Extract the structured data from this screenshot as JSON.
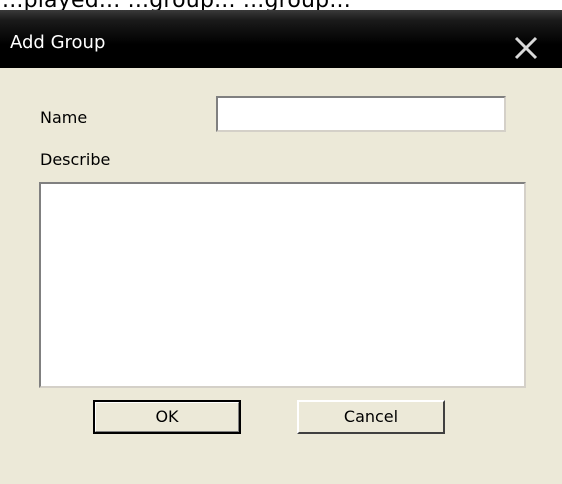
{
  "background_window": {
    "partial_text": "...played... ...group... ...group..."
  },
  "dialog": {
    "title": "Add Group",
    "close_glyph": "✕",
    "fields": {
      "name": {
        "label": "Name",
        "value": "",
        "placeholder": ""
      },
      "describe": {
        "label": "Describe",
        "value": "",
        "placeholder": ""
      }
    },
    "buttons": {
      "ok": "OK",
      "cancel": "Cancel"
    }
  },
  "colors": {
    "dialog_bg": "#ece9d8",
    "titlebar": "#000000",
    "title_text": "#ffffff"
  }
}
